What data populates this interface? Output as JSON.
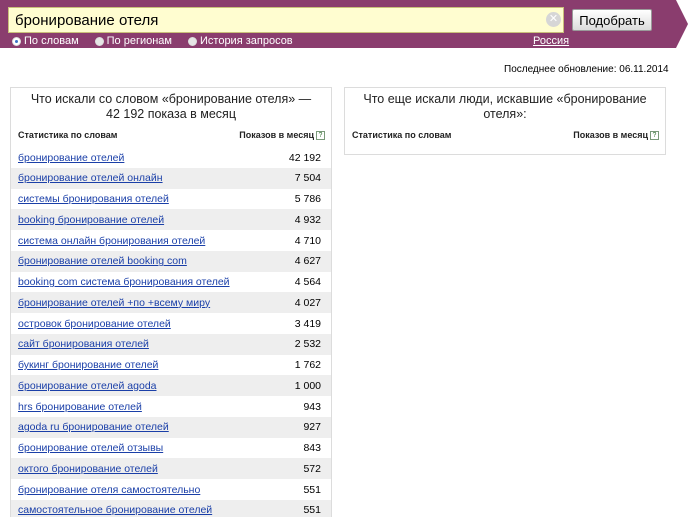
{
  "search": {
    "query": "бронирование отеля",
    "submit_label": "Подобрать",
    "clear_icon": "clear-icon"
  },
  "modes": [
    {
      "label": "По словам",
      "selected": true
    },
    {
      "label": "По регионам",
      "selected": false
    },
    {
      "label": "История запросов",
      "selected": false
    }
  ],
  "region": "Россия",
  "last_update": "Последнее обновление: 06.11.2014",
  "left_panel": {
    "title": "Что искали со словом «бронирование отеля» — 42 192 показа в месяц",
    "col_phrase": "Статистика по словам",
    "col_shows": "Показов в месяц",
    "help_mark": "?",
    "rows": [
      {
        "phrase": "бронирование отелей",
        "count": "42 192"
      },
      {
        "phrase": "бронирование отелей онлайн",
        "count": "7 504"
      },
      {
        "phrase": "системы бронирования отелей",
        "count": "5 786"
      },
      {
        "phrase": "booking бронирование отелей",
        "count": "4 932"
      },
      {
        "phrase": "система онлайн бронирования отелей",
        "count": "4 710"
      },
      {
        "phrase": "бронирование отелей booking com",
        "count": "4 627"
      },
      {
        "phrase": "booking com система бронирования отелей",
        "count": "4 564"
      },
      {
        "phrase": "бронирование отелей +по +всему миру",
        "count": "4 027"
      },
      {
        "phrase": "островок бронирование отелей",
        "count": "3 419"
      },
      {
        "phrase": "сайт бронирования отелей",
        "count": "2 532"
      },
      {
        "phrase": "букинг бронирование отелей",
        "count": "1 762"
      },
      {
        "phrase": "бронирование отелей agoda",
        "count": "1 000"
      },
      {
        "phrase": "hrs бронирование отелей",
        "count": "943"
      },
      {
        "phrase": "agoda ru бронирование отелей",
        "count": "927"
      },
      {
        "phrase": "бронирование отелей отзывы",
        "count": "843"
      },
      {
        "phrase": "октого бронирование отелей",
        "count": "572"
      },
      {
        "phrase": "бронирование отеля самостоятельно",
        "count": "551"
      },
      {
        "phrase": "самостоятельное бронирование отелей",
        "count": "551"
      }
    ]
  },
  "right_panel": {
    "title": "Что еще искали люди, искавшие «бронирование отеля»:",
    "col_phrase": "Статистика по словам",
    "col_shows": "Показов в месяц",
    "help_mark": "?"
  },
  "colors": {
    "topbar": "#8a3d6e",
    "input_bg": "#fffdd0",
    "link": "#1a3fa8",
    "row_alt": "#eeeeee"
  }
}
